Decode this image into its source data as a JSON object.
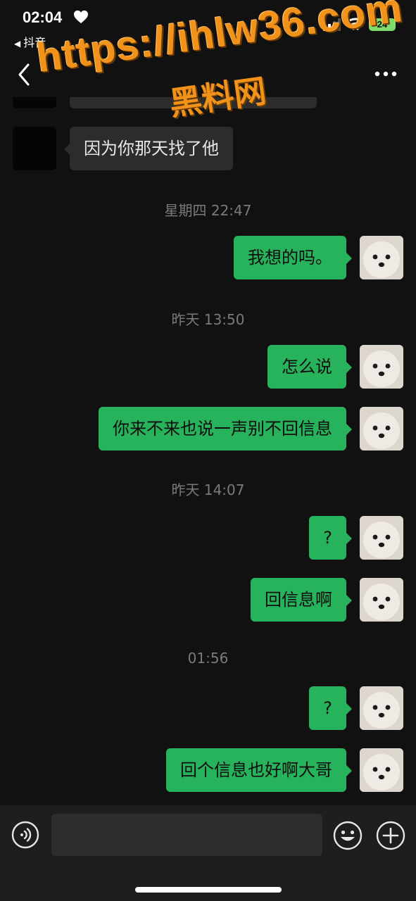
{
  "status_bar": {
    "time": "02:04",
    "back_app": "抖音",
    "battery": "24"
  },
  "nav": {
    "title": " "
  },
  "watermark": {
    "url": "https://ihlw36.com",
    "label": "黑料网"
  },
  "messages": [
    {
      "direction": "in",
      "text": "因为你那天找了他"
    },
    {
      "type": "time",
      "text": "星期四 22:47"
    },
    {
      "direction": "out",
      "text": "我想的吗。"
    },
    {
      "type": "time",
      "text": "昨天 13:50"
    },
    {
      "direction": "out",
      "text": "怎么说"
    },
    {
      "direction": "out",
      "text": "你来不来也说一声别不回信息"
    },
    {
      "type": "time",
      "text": "昨天 14:07"
    },
    {
      "direction": "out",
      "text": "?"
    },
    {
      "direction": "out",
      "text": "回信息啊"
    },
    {
      "type": "time",
      "text": "01:56"
    },
    {
      "direction": "out",
      "text": "?"
    },
    {
      "direction": "out",
      "text": "回个信息也好啊大哥"
    }
  ],
  "input": {
    "placeholder": ""
  },
  "colors": {
    "background": "#111111",
    "bubble_out": "#26b35b",
    "bubble_in": "#2c2c2c",
    "watermark": "#f1921a"
  },
  "icons": {
    "back": "chevron-left-icon",
    "more": "more-dots-icon",
    "voice": "voice-icon",
    "emoji": "emoji-icon",
    "plus": "plus-icon"
  }
}
